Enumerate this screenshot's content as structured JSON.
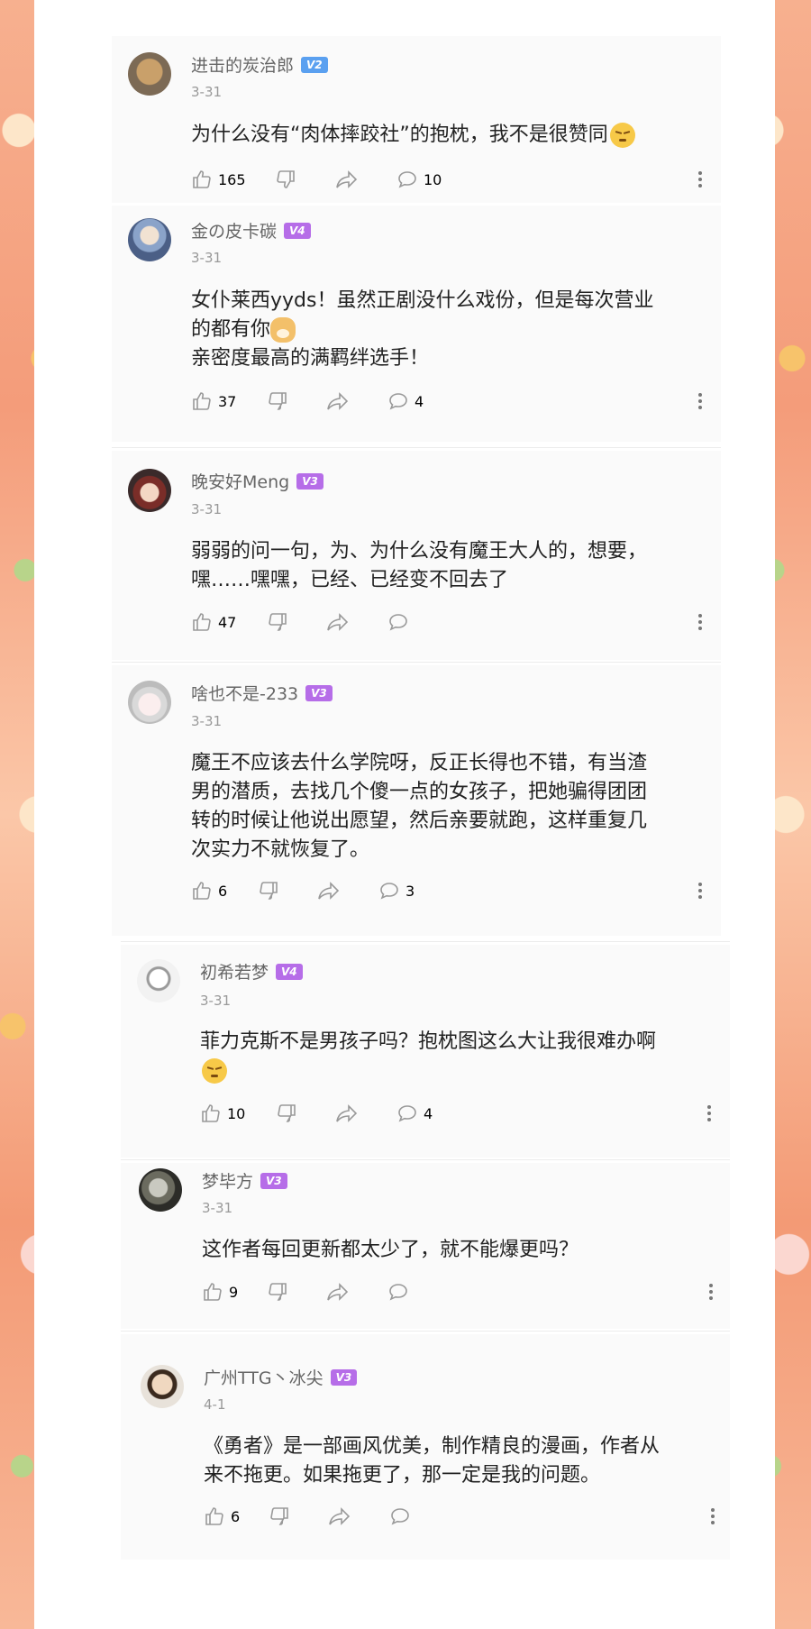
{
  "colors": {
    "v2": "#5aa0f0",
    "v3": "#b66de8",
    "v4": "#b66de8"
  },
  "comments": [
    {
      "username": "进击的炭治郎",
      "level": "V2",
      "date": "3-31",
      "lines": [
        "为什么没有“肉体摔跤社”的抱枕，我不是很赞同"
      ],
      "emoji": "smirk-emoji",
      "likes": "165",
      "replies": "10"
    },
    {
      "username": "金の皮卡碳",
      "level": "V4",
      "date": "3-31",
      "lines": [
        "女仆莱西yyds！虽然正剧没什么戏份，但是每次营业",
        "的都有你",
        "亲密度最高的满羁绊选手！"
      ],
      "emoji": "doge-emoji",
      "likes": "37",
      "replies": "4"
    },
    {
      "username": "晚安好Meng",
      "level": "V3",
      "date": "3-31",
      "lines": [
        "弱弱的问一句，为、为什么没有魔王大人的，想要，",
        "嘿……嘿嘿，已经、已经变不回去了"
      ],
      "likes": "47",
      "replies": ""
    },
    {
      "username": "啥也不是-233",
      "level": "V3",
      "date": "3-31",
      "lines": [
        "魔王不应该去什么学院呀，反正长得也不错，有当渣",
        "男的潜质，去找几个傻一点的女孩子，把她骗得团团",
        "转的时候让他说出愿望，然后亲要就跑，这样重复几",
        "次实力不就恢复了。"
      ],
      "likes": "6",
      "replies": "3"
    },
    {
      "username": "初希若梦",
      "level": "V4",
      "date": "3-31",
      "lines": [
        "菲力克斯不是男孩子吗？抱枕图这么大让我很难办啊"
      ],
      "emoji": "smirk-emoji",
      "likes": "10",
      "replies": "4"
    },
    {
      "username": "梦毕方",
      "level": "V3",
      "date": "3-31",
      "lines": [
        "这作者每回更新都太少了，就不能爆更吗？"
      ],
      "likes": "9",
      "replies": ""
    },
    {
      "username": "广州TTG丶冰尖",
      "level": "V3",
      "date": "4-1",
      "lines": [
        "《勇者》是一部画风优美，制作精良的漫画，作者从",
        "来不拖更。如果拖更了，那一定是我的问题。"
      ],
      "likes": "6",
      "replies": ""
    }
  ]
}
